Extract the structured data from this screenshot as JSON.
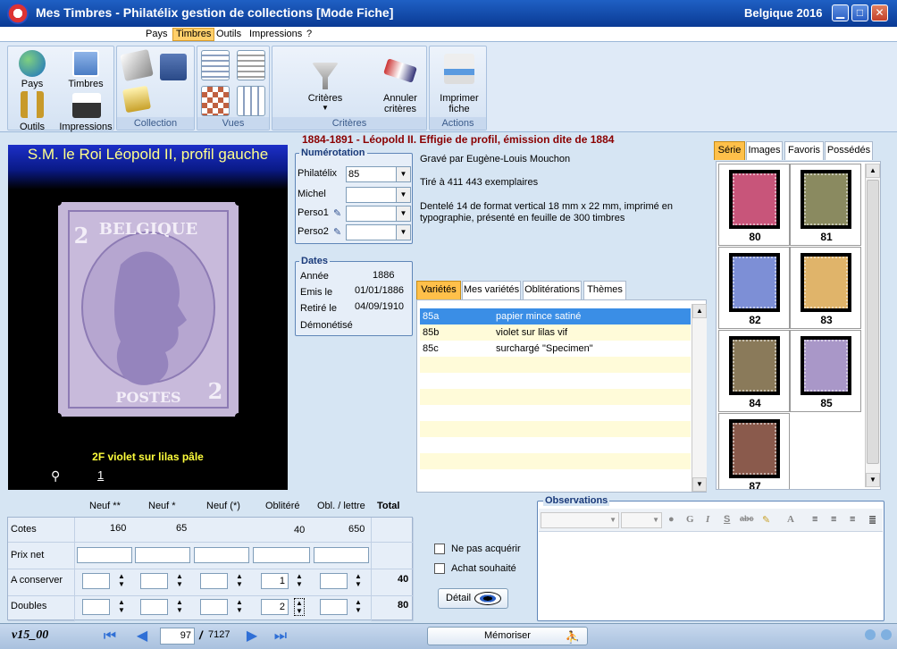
{
  "window": {
    "title": "Mes Timbres - Philatélix gestion de collections [Mode Fiche]",
    "right_title": "Belgique 2016",
    "min": "▁",
    "max": "□",
    "close": "✕"
  },
  "menu": [
    "Pays",
    "Timbres",
    "Outils",
    "Impressions",
    "?"
  ],
  "ribbon": {
    "nav": [
      "Pays",
      "Timbres",
      "Outils",
      "Impressions"
    ],
    "groups": {
      "collection": "Collection",
      "vues": "Vues",
      "criteres": "Critères",
      "actions": "Actions"
    },
    "criteres_btn": "Critères",
    "annuler_btn_l1": "Annuler",
    "annuler_btn_l2": "critères",
    "imprimer_btn_l1": "Imprimer",
    "imprimer_btn_l2": "fiche"
  },
  "stamp": {
    "title": "S.M. le Roi Léopold II, profil gauche",
    "caption": "2F violet sur lilas pâle",
    "image_count": "1",
    "image_text_top": "BELGIQUE",
    "image_text_bottom": "POSTES",
    "image_value": "2"
  },
  "series_title": "1884-1891 - Léopold II. Effigie de profil, émission dite de 1884",
  "numerotation": {
    "legend": "Numérotation",
    "rows": [
      {
        "label": "Philatélix",
        "value": "85"
      },
      {
        "label": "Michel",
        "value": ""
      },
      {
        "label": "Perso1",
        "value": ""
      },
      {
        "label": "Perso2",
        "value": ""
      }
    ]
  },
  "dates": {
    "legend": "Dates",
    "annee_label": "Année",
    "annee": "1886",
    "emis_label": "Emis le",
    "emis": "01/01/1886",
    "retire_label": "Retiré le",
    "retire": "04/09/1910",
    "demonetise_label": "Démonétisé"
  },
  "description": {
    "line1": "Gravé par Eugène-Louis Mouchon",
    "line2": "Tiré à 411 443 exemplaires",
    "line3a": "Dentelé 14 de format vertical 18 mm x 22 mm, imprimé en",
    "line3b": "typographie, présenté en feuille de 300 timbres"
  },
  "tabs": [
    "Variétés",
    "Mes variétés",
    "Oblitérations",
    "Thèmes"
  ],
  "varietes": [
    {
      "code": "85a",
      "desc": "papier mince satiné"
    },
    {
      "code": "85b",
      "desc": "violet sur lilas vif"
    },
    {
      "code": "85c",
      "desc": "surchargé \"Specimen\""
    }
  ],
  "right_tabs": [
    "Série",
    "Images",
    "Favoris",
    "Possédés"
  ],
  "thumbs": [
    {
      "num": "80",
      "color": "#c8557a"
    },
    {
      "num": "81",
      "color": "#8a8a60"
    },
    {
      "num": "82",
      "color": "#7d8fd6"
    },
    {
      "num": "83",
      "color": "#e0b46a"
    },
    {
      "num": "84",
      "color": "#8a7a5a"
    },
    {
      "num": "85",
      "color": "#a997c8"
    },
    {
      "num": "87",
      "color": "#8a5a4c"
    }
  ],
  "table": {
    "cols": [
      "Neuf **",
      "Neuf *",
      "Neuf (*)",
      "Oblitéré",
      "Obl. / lettre",
      "Total"
    ],
    "rows": {
      "cotes": {
        "label": "Cotes",
        "values": [
          "160",
          "65",
          "",
          "40",
          "650"
        ]
      },
      "prix": {
        "label": "Prix net"
      },
      "conserver": {
        "label": "A conserver",
        "values": [
          "",
          "",
          "",
          "1",
          ""
        ],
        "total": "40"
      },
      "doubles": {
        "label": "Doubles",
        "values": [
          "",
          "",
          "",
          "2",
          ""
        ],
        "total": "80"
      }
    }
  },
  "checks": {
    "ne_pas": "Ne pas acquérir",
    "souhaite": "Achat souhaité"
  },
  "detail_btn": "Détail",
  "observations": {
    "legend": "Observations"
  },
  "status": {
    "version": "v15_00",
    "current": "97",
    "separator": "/",
    "total": "7127",
    "memoriser": "Mémoriser"
  }
}
